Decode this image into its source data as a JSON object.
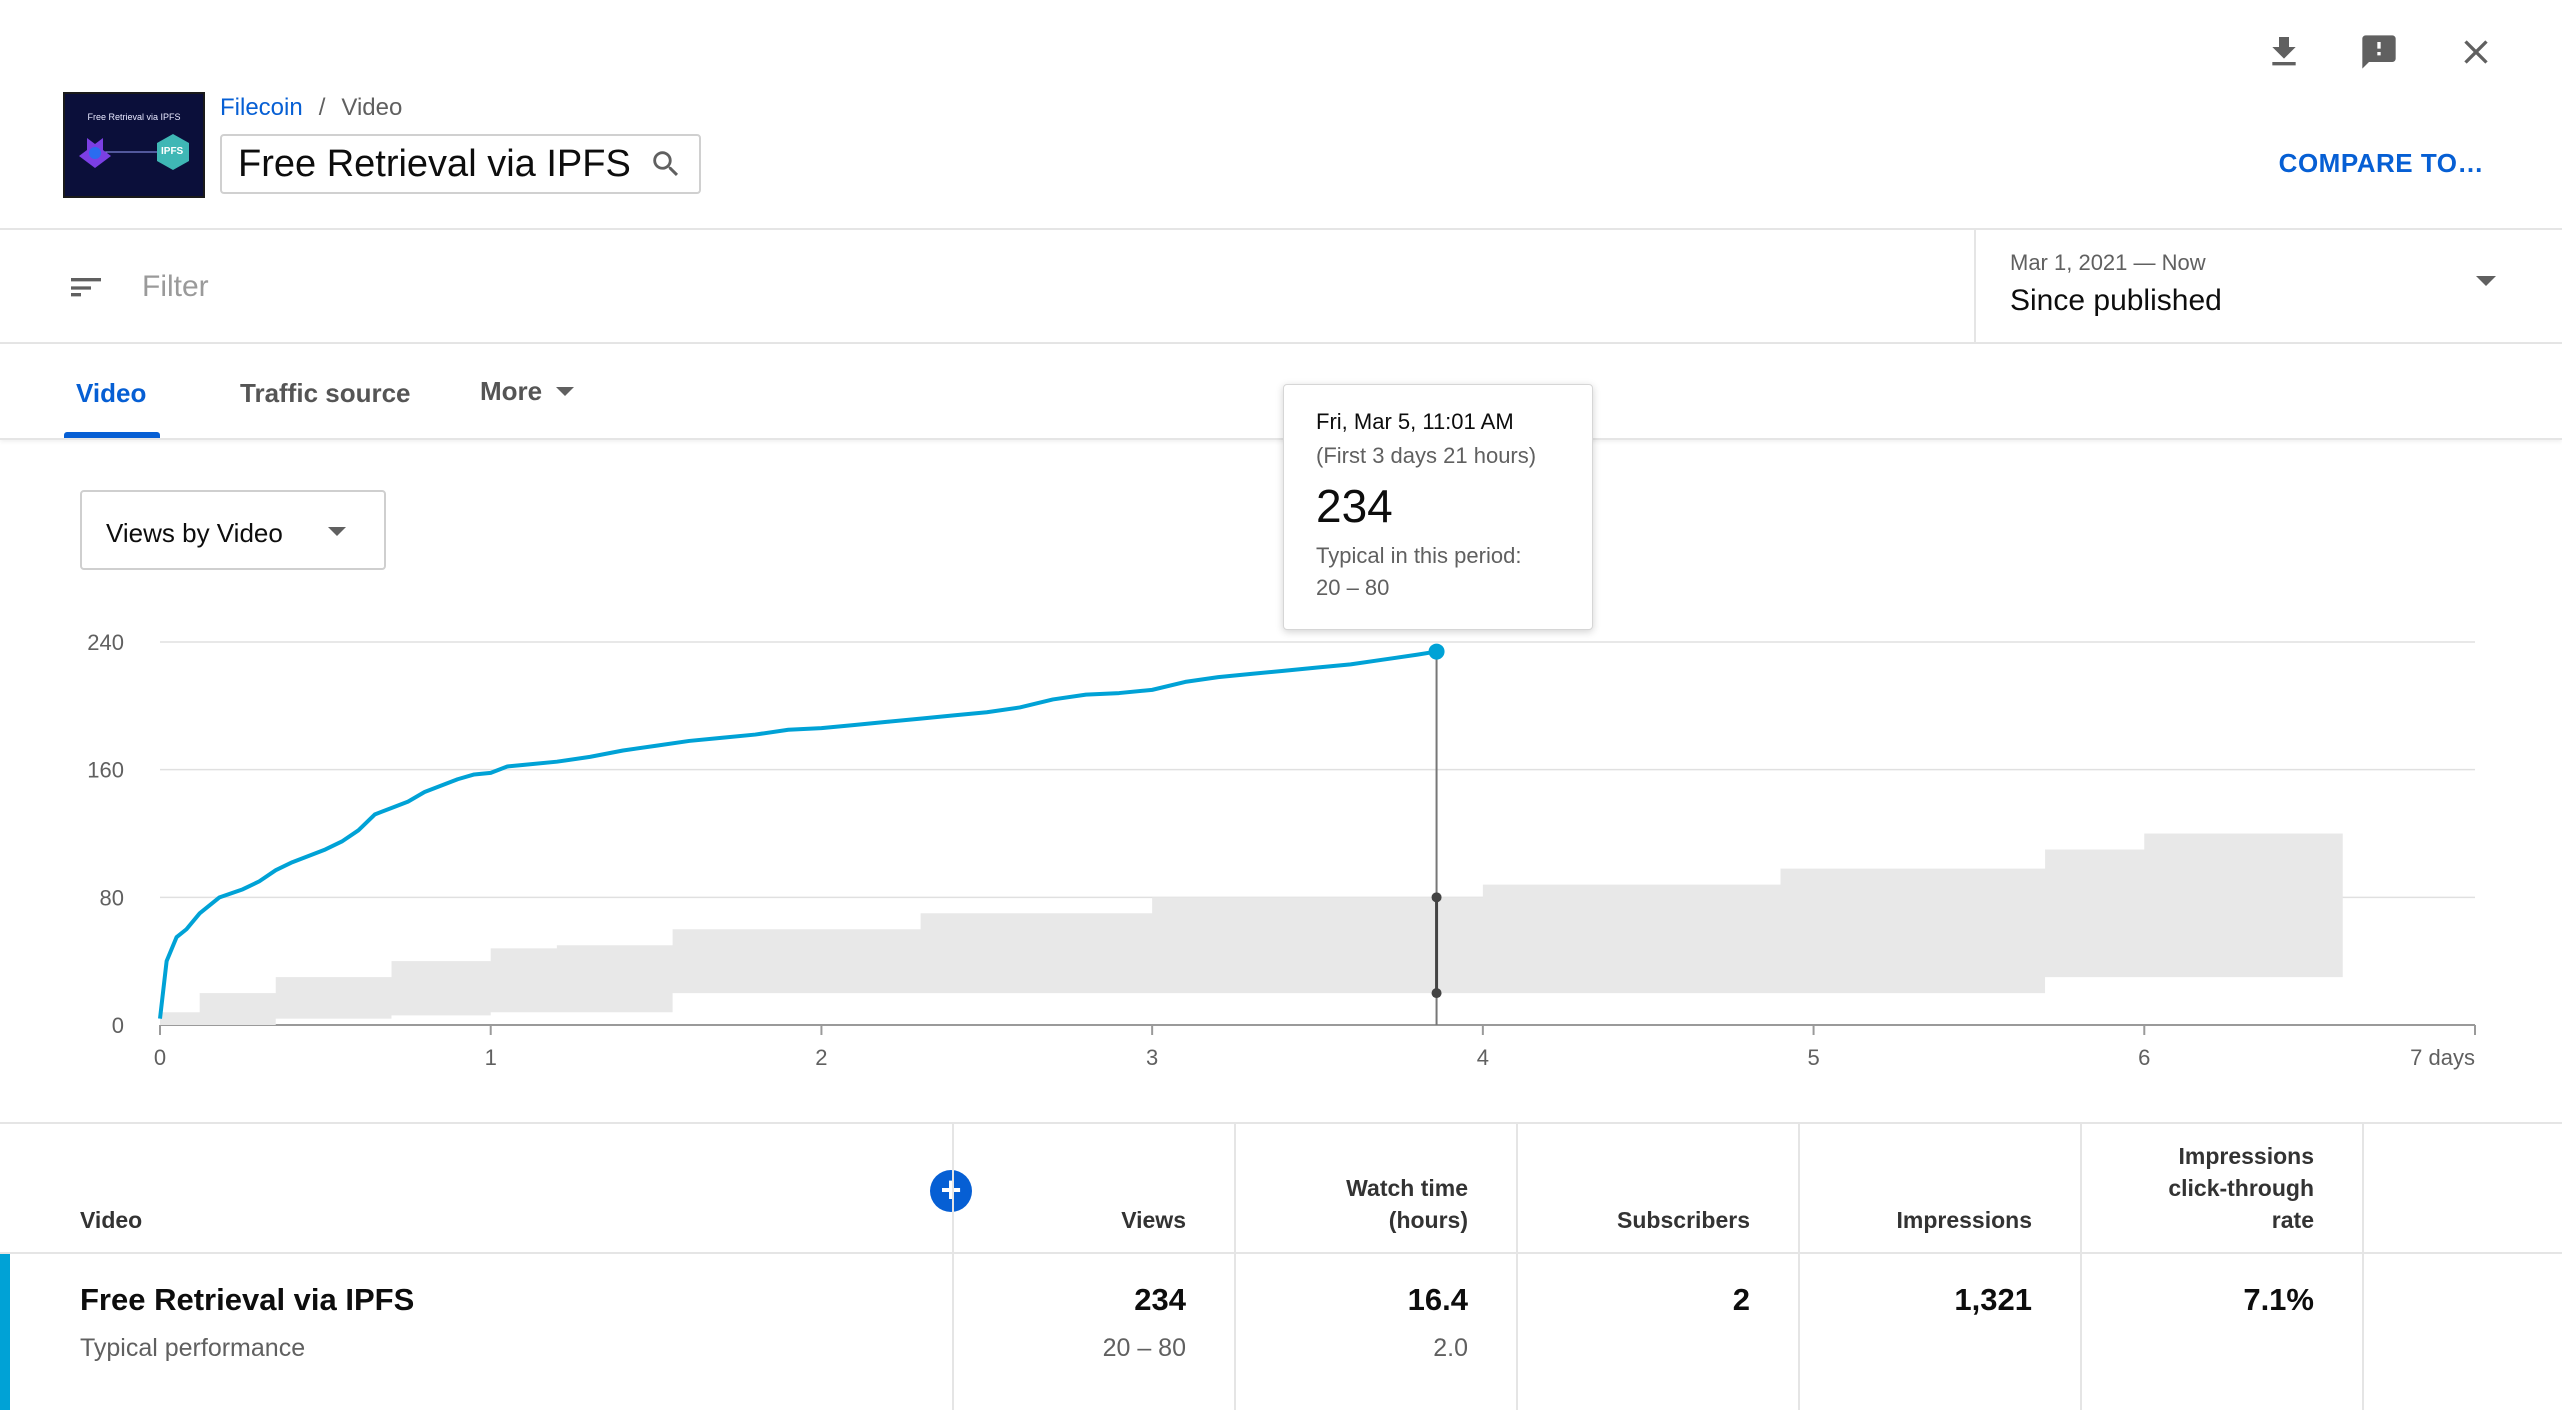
{
  "header": {
    "breadcrumb_channel": "Filecoin",
    "breadcrumb_separator": "/",
    "breadcrumb_section": "Video",
    "video_title": "Free Retrieval via IPFS",
    "compare_label": "COMPARE TO…",
    "thumbnail_caption": "Free Retrieval via IPFS",
    "thumbnail_badge": "IPFS",
    "icons": [
      "download-icon",
      "feedback-icon",
      "close-icon"
    ]
  },
  "filter": {
    "placeholder": "Filter",
    "date_range": "Mar 1, 2021 — Now",
    "date_preset": "Since published"
  },
  "tabs": {
    "video": "Video",
    "traffic_source": "Traffic source",
    "more": "More"
  },
  "metric_select": "Views by Video",
  "tooltip": {
    "date": "Fri, Mar 5, 11:01 AM",
    "span": "(First 3 days 21 hours)",
    "value": "234",
    "typical_label": "Typical in this period:",
    "typical_range": "20 – 80"
  },
  "chart_data": {
    "type": "line",
    "x_ticks": [
      "0",
      "1",
      "2",
      "3",
      "4",
      "5",
      "6",
      "7 days"
    ],
    "y_ticks": [
      "0",
      "80",
      "160",
      "240"
    ],
    "ylim": [
      0,
      240
    ],
    "xlim": [
      0,
      7
    ],
    "grid": true,
    "series": [
      {
        "name": "",
        "color": "#00a2d6",
        "x": [
          0,
          0.02,
          0.05,
          0.08,
          0.12,
          0.18,
          0.25,
          0.3,
          0.35,
          0.4,
          0.45,
          0.5,
          0.55,
          0.6,
          0.65,
          0.7,
          0.75,
          0.8,
          0.85,
          0.9,
          0.95,
          1.0,
          1.05,
          1.1,
          1.2,
          1.3,
          1.4,
          1.5,
          1.6,
          1.7,
          1.8,
          1.9,
          2.0,
          2.1,
          2.2,
          2.3,
          2.4,
          2.5,
          2.6,
          2.7,
          2.8,
          2.9,
          3.0,
          3.1,
          3.2,
          3.3,
          3.4,
          3.5,
          3.6,
          3.7,
          3.8,
          3.86
        ],
        "y": [
          4,
          40,
          55,
          60,
          70,
          80,
          85,
          90,
          97,
          102,
          106,
          110,
          115,
          122,
          132,
          136,
          140,
          146,
          150,
          154,
          157,
          158,
          162,
          163,
          165,
          168,
          172,
          175,
          178,
          180,
          182,
          185,
          186,
          188,
          190,
          192,
          194,
          196,
          199,
          204,
          207,
          208,
          210,
          215,
          218,
          220,
          222,
          224,
          226,
          229,
          232,
          234
        ]
      }
    ],
    "typical_band": {
      "color": "#e8e8e8",
      "x": [
        0,
        0.12,
        0.35,
        0.7,
        1.0,
        1.2,
        1.55,
        1.8,
        2.3,
        2.6,
        3.0,
        3.2,
        4.0,
        4.3,
        4.9,
        5.2,
        5.7,
        6.0,
        6.6
      ],
      "low": [
        0,
        0,
        4,
        6,
        8,
        8,
        20,
        20,
        20,
        20,
        20,
        20,
        20,
        20,
        20,
        20,
        30,
        30,
        30
      ],
      "high": [
        8,
        20,
        30,
        40,
        48,
        50,
        60,
        60,
        70,
        70,
        80,
        80,
        88,
        88,
        98,
        98,
        110,
        120,
        120
      ]
    },
    "hover": {
      "x": 3.86,
      "value": 234,
      "typical_low": 20,
      "typical_high": 80
    }
  },
  "table": {
    "columns": [
      {
        "key": "video",
        "label": "Video"
      },
      {
        "key": "views",
        "label": "Views"
      },
      {
        "key": "watch_time",
        "label": "Watch time\n(hours)"
      },
      {
        "key": "subscribers",
        "label": "Subscribers"
      },
      {
        "key": "impressions",
        "label": "Impressions"
      },
      {
        "key": "ctr",
        "label": "Impressions\nclick-through\nrate"
      }
    ],
    "row": {
      "title": "Free Retrieval via IPFS",
      "typical_label": "Typical performance",
      "views": "234",
      "views_typical": "20 – 80",
      "watch_time": "16.4",
      "watch_time_typical": "2.0",
      "subscribers": "2",
      "impressions": "1,321",
      "ctr": "7.1%"
    },
    "add_metric_label": "+"
  }
}
